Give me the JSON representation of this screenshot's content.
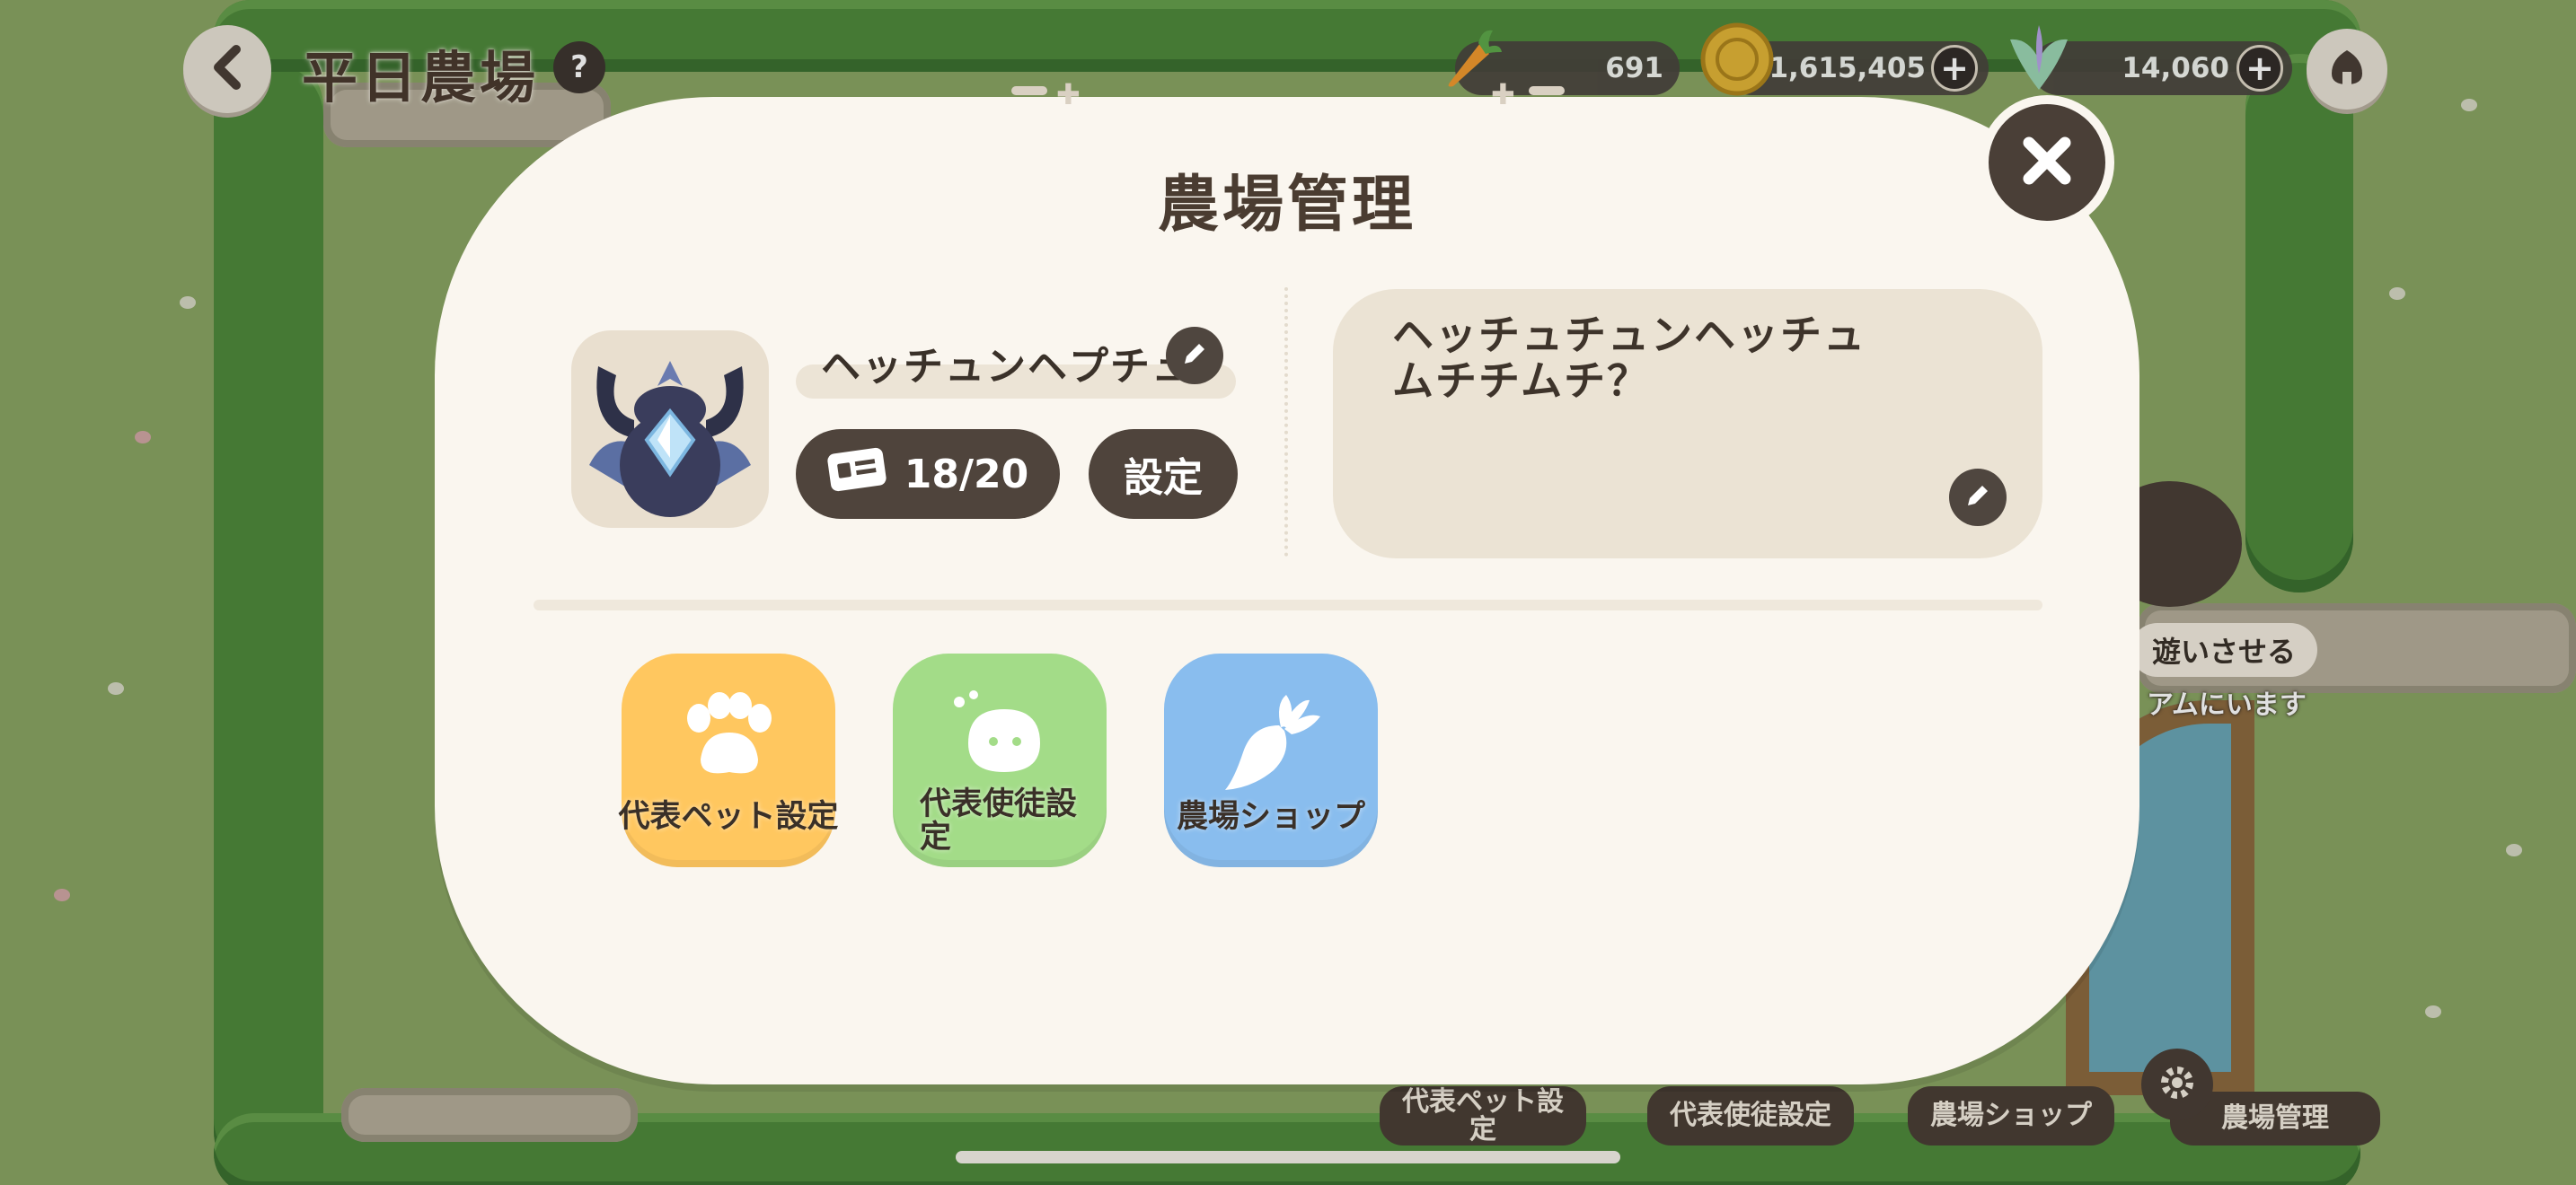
{
  "hud": {
    "farm_title": "平日農場",
    "help_label": "?",
    "carrot_count": "691",
    "coin_count": "1,615,405",
    "gem_count": "14,060",
    "plus_label": "+"
  },
  "scene": {
    "bubble_text_1": "遊いさせる",
    "bubble_text_2": "アムにいます"
  },
  "bottom_bar": {
    "tabs": [
      {
        "label": "代表ペット設定"
      },
      {
        "label": "代表使徒設定"
      },
      {
        "label": "農場ショップ"
      },
      {
        "label": "農場管理"
      }
    ]
  },
  "modal": {
    "title": "農場管理",
    "farm_name": "ヘッチュンヘプチュ",
    "member_count": "18/20",
    "settings_label": "設定",
    "bio": "ヘッチュチュンヘッチュムチチムチ？",
    "tiles": [
      {
        "label": "代表ペット設定",
        "color": "#ffc75f"
      },
      {
        "label": "代表使徒設定",
        "color": "#a3dc88"
      },
      {
        "label": "農場ショップ",
        "color": "#89bdee"
      }
    ]
  },
  "colors": {
    "modal_bg": "#faf6ef",
    "dark_button": "#4f443c",
    "text_dark": "#3a3129"
  },
  "icons": [
    "back-arrow-icon",
    "help-icon",
    "carrot-icon",
    "coin-icon",
    "gem-icon",
    "home-icon",
    "close-icon",
    "pencil-icon",
    "id-card-icon",
    "paw-icon",
    "spirit-icon",
    "radish-icon",
    "gear-icon"
  ]
}
